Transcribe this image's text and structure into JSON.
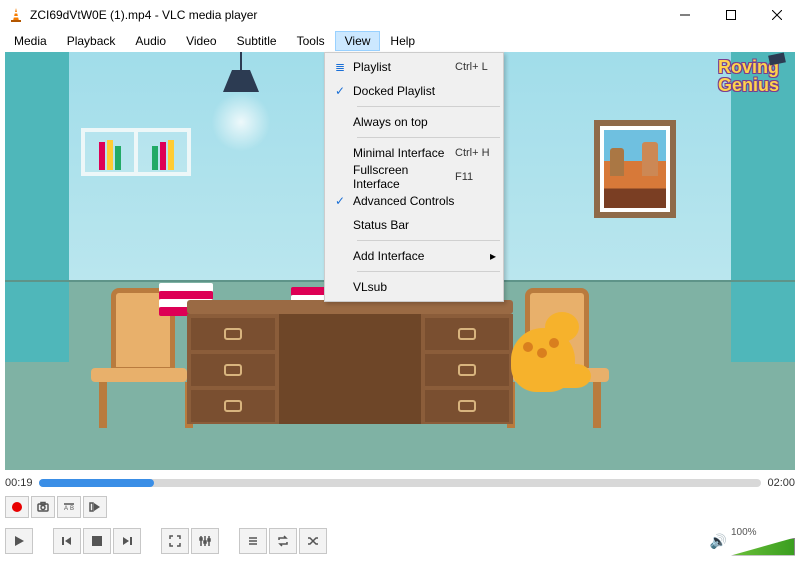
{
  "window": {
    "title": "ZCI69dVtW0E (1).mp4 - VLC media player"
  },
  "menubar": {
    "items": [
      "Media",
      "Playback",
      "Audio",
      "Video",
      "Subtitle",
      "Tools",
      "View",
      "Help"
    ],
    "active_index": 6
  },
  "view_menu": {
    "playlist": {
      "label": "Playlist",
      "shortcut": "Ctrl+ L"
    },
    "docked_playlist": {
      "label": "Docked Playlist",
      "checked": true
    },
    "always_on_top": {
      "label": "Always on top"
    },
    "minimal_interface": {
      "label": "Minimal Interface",
      "shortcut": "Ctrl+ H"
    },
    "fullscreen_interface": {
      "label": "Fullscreen Interface",
      "shortcut": "F11"
    },
    "advanced_controls": {
      "label": "Advanced Controls",
      "checked": true
    },
    "status_bar": {
      "label": "Status Bar"
    },
    "add_interface": {
      "label": "Add Interface"
    },
    "vlsub": {
      "label": "VLsub"
    }
  },
  "video_content": {
    "brand_line1": "Roving",
    "brand_line2": "Genius"
  },
  "playback": {
    "elapsed": "00:19",
    "total": "02:00",
    "progress_percent": 16
  },
  "volume": {
    "percent_label": "100%"
  }
}
